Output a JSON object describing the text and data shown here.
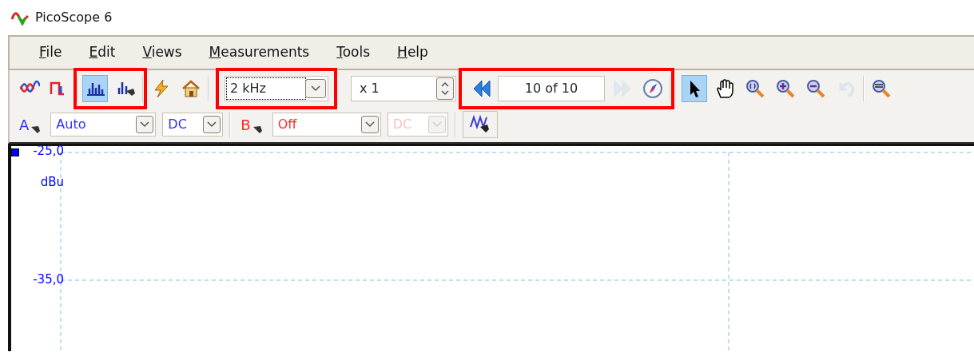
{
  "window": {
    "title": "PicoScope 6"
  },
  "menu": [
    {
      "label": "File"
    },
    {
      "label": "Edit"
    },
    {
      "label": "Views"
    },
    {
      "label": "Measurements"
    },
    {
      "label": "Tools"
    },
    {
      "label": "Help"
    }
  ],
  "toolbar_groups": [
    {
      "highlighted": false,
      "items": [
        {
          "kind": "button",
          "selected": false,
          "disabled": false
        },
        {
          "kind": "button",
          "selected": false,
          "disabled": false
        }
      ]
    },
    {
      "highlighted": true,
      "items": [
        {
          "kind": "button",
          "selected": true,
          "disabled": false
        },
        {
          "kind": "button",
          "selected": false,
          "disabled": false
        }
      ]
    },
    {
      "highlighted": false,
      "items": [
        {
          "kind": "button",
          "selected": false,
          "disabled": false
        },
        {
          "kind": "button",
          "selected": false,
          "disabled": false
        }
      ]
    },
    {
      "highlighted": true,
      "items": [
        {
          "kind": "combo",
          "value": "2 kHz",
          "focused": true
        }
      ]
    },
    {
      "highlighted": false,
      "items": [
        {
          "kind": "spin",
          "value": "x 1"
        }
      ]
    },
    {
      "highlighted": true,
      "items": [
        {
          "kind": "button",
          "selected": false,
          "disabled": false
        },
        {
          "kind": "counter",
          "value": "10 of 10"
        },
        {
          "kind": "button",
          "selected": false,
          "disabled": true
        },
        {
          "kind": "button",
          "selected": false,
          "disabled": false
        }
      ]
    },
    {
      "highlighted": false,
      "items": [
        {
          "kind": "button",
          "selected": true,
          "disabled": false
        },
        {
          "kind": "button",
          "selected": false,
          "disabled": false
        },
        {
          "kind": "button",
          "selected": false,
          "disabled": false
        },
        {
          "kind": "button",
          "selected": false,
          "disabled": false
        },
        {
          "kind": "button",
          "selected": false,
          "disabled": false
        },
        {
          "kind": "button",
          "selected": false,
          "disabled": true
        }
      ]
    },
    {
      "highlighted": false,
      "items": [
        {
          "kind": "button",
          "selected": false,
          "disabled": false
        }
      ]
    }
  ],
  "channels": [
    {
      "label": "A",
      "color": "#3030ff",
      "range": "Auto",
      "coupling": "DC",
      "coupling_disabled": false
    },
    {
      "label": "B",
      "color": "#ff2a2a",
      "range": "Off",
      "coupling": "DC",
      "coupling_disabled": true
    }
  ],
  "plot": {
    "color": "#0000ff",
    "unit": "dBu",
    "y_labels": [
      {
        "text": "-25,0"
      },
      {
        "text": "-35,0"
      }
    ]
  }
}
